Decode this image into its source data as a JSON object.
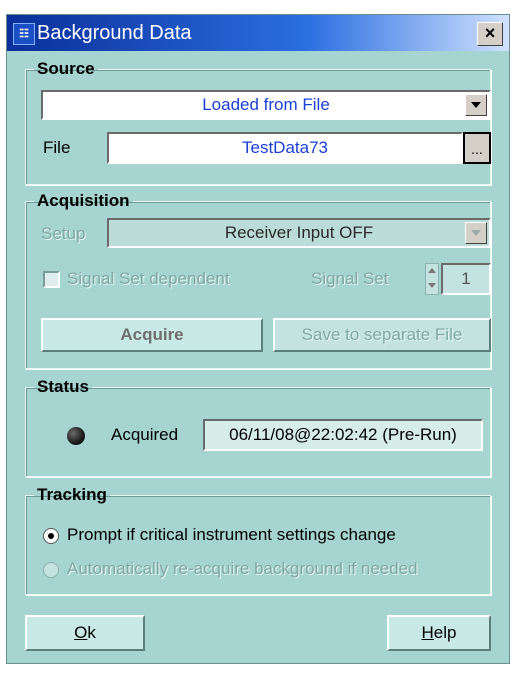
{
  "window": {
    "title": "Background Data",
    "icon": "app-logo-icon",
    "close_label": "×"
  },
  "source": {
    "legend": "Source",
    "mode_value": "Loaded from File",
    "file_label": "File",
    "file_value": "TestData73",
    "browse_label": "..."
  },
  "acquisition": {
    "legend": "Acquisition",
    "setup_label": "Setup",
    "setup_value": "Receiver Input OFF",
    "signal_set_dependent_label": "Signal Set dependent",
    "signal_set_label": "Signal Set",
    "signal_set_value": "1",
    "acquire_label": "Acquire",
    "save_label": "Save to separate File"
  },
  "status": {
    "legend": "Status",
    "indicator_color": "#1a1a1a",
    "state_label": "Acquired",
    "timestamp": "06/11/08@22:02:42 (Pre-Run)"
  },
  "tracking": {
    "legend": "Tracking",
    "option1": "Prompt if critical instrument settings change",
    "option2": "Automatically re-acquire background if needed"
  },
  "buttons": {
    "ok_prefix": "O",
    "ok_rest": "k",
    "help_prefix": "H",
    "help_rest": "elp"
  },
  "colors": {
    "dialog_bg": "#a6d4d0",
    "title_bar": "#0a2f9a",
    "value_text": "#1a3fd6"
  }
}
